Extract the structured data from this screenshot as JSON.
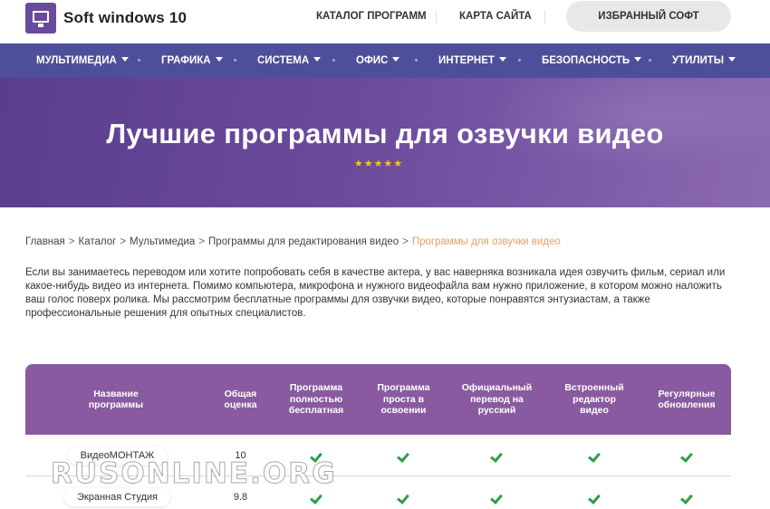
{
  "header": {
    "logo_text": "Soft windows 10",
    "catalog_link": "КАТАЛОГ ПРОГРАММ",
    "sitemap_link": "КАРТА САЙТА",
    "favorites_button": "ИЗБРАННЫЙ СОФТ"
  },
  "nav": {
    "items": [
      {
        "label": "МУЛЬТИМЕДИА"
      },
      {
        "label": "ГРАФИКА"
      },
      {
        "label": "СИСТЕМА"
      },
      {
        "label": "ОФИС"
      },
      {
        "label": "ИНТЕРНЕТ"
      },
      {
        "label": "БЕЗОПАСНОСТЬ"
      },
      {
        "label": "УТИЛИТЫ"
      }
    ]
  },
  "hero": {
    "title": "Лучшие программы для озвучки видео",
    "stars": "★★★★★",
    "rating_stars": 5
  },
  "breadcrumb": {
    "items": [
      "Главная",
      "Каталог",
      "Мультимедиа",
      "Программы для редактирования видео"
    ],
    "current": "Программы для озвучки видео",
    "separator": ">"
  },
  "intro": {
    "text": "Если вы занимаетесь переводом или хотите попробовать себя в качестве актера, у вас наверняка возникала идея озвучить фильм, сериал или какое-нибудь видео из интернета. Помимо компьютера, микрофона и нужного видеофайла вам нужно приложение, в котором можно наложить ваш голос поверх ролика. Мы рассмотрим бесплатные программы для озвучки видео, которые понравятся энтузиастам, а также профессиональные решения для опытных специалистов."
  },
  "table": {
    "headers": [
      "Название программы",
      "Общая оценка",
      "Программа полностью бесплатная",
      "Программа проста в освоении",
      "Официальный перевод на русский",
      "Встроенный редактор видео",
      "Регулярные обновления"
    ],
    "rows": [
      {
        "name": "ВидеоМОНТАЖ",
        "score": "10",
        "checks": [
          true,
          true,
          true,
          true,
          true
        ]
      },
      {
        "name": "Экранная Студия",
        "score": "9.8",
        "checks": [
          true,
          true,
          true,
          true,
          true
        ]
      }
    ]
  },
  "watermark": "RUSONLINE.ORG",
  "colors": {
    "nav_bg": "#4e4f9a",
    "hero_bg": "#6b4a9b",
    "table_header": "#8a5aa0",
    "breadcrumb_current": "#e8a060",
    "check": "#2e9e44"
  }
}
